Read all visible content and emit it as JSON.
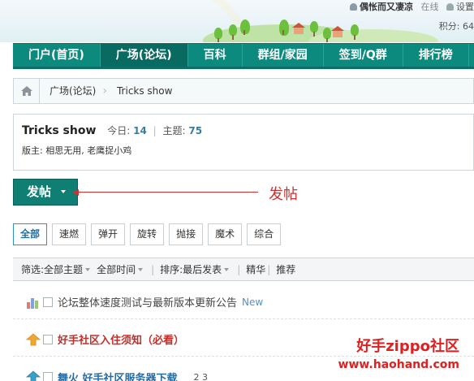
{
  "header": {
    "user_name": "偶怅而又凄凉",
    "status": "在线",
    "settings": "设置",
    "points_label": "积分: 64"
  },
  "nav": {
    "items": [
      "门户(首页)",
      "广场(论坛)",
      "百科",
      "群组/家园",
      "签到/Q群",
      "排行榜"
    ],
    "active_index": 1
  },
  "breadcrumb": {
    "items": [
      "广场(论坛)",
      "Tricks show"
    ]
  },
  "forum": {
    "title": "Tricks show",
    "today_label": "今日:",
    "today_value": "14",
    "topics_label": "主题:",
    "topics_value": "75",
    "moderators": "版主: 相思无用, 老鹰捉小鸡"
  },
  "post_button": {
    "label": "发帖"
  },
  "annotation": {
    "text": "发帖",
    "color": "#d03030"
  },
  "type_tabs": {
    "items": [
      "全部",
      "速燃",
      "弹开",
      "旋转",
      "抛接",
      "魔术",
      "综合"
    ],
    "active_index": 0
  },
  "filter": {
    "filter_label": "筛选:",
    "topic_filter": "全部主题",
    "time_filter": "全部时间",
    "sort_label": "排序:",
    "sort_value": "最后发表",
    "digest": "精华",
    "recommend": "推荐"
  },
  "threads": [
    {
      "icon": "bar-chart-icon",
      "title": "论坛整体速度测试与最新版本更新公告",
      "tag": "New"
    },
    {
      "icon": "pinned-up-arrow-icon",
      "title": "好手社区入住须知（必看）"
    },
    {
      "icon": "pinned-up-arrow-icon",
      "title": "舞火 好手社区服务器下载",
      "pages": "2  3"
    }
  ],
  "watermark": {
    "line1": "好手zippo社区",
    "line2": "www.haohand.com"
  },
  "colors": {
    "nav_bg": "#0c8a7e",
    "accent_red": "#d03030",
    "thread_hot": "#c0302a"
  }
}
